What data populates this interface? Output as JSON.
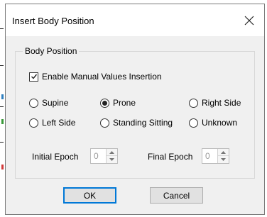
{
  "dialog": {
    "title": "Insert Body Position",
    "close_icon": "close-icon"
  },
  "group": {
    "legend": "Body Position",
    "enable_manual": {
      "label": "Enable Manual Values Insertion",
      "checked": true
    }
  },
  "positions": [
    {
      "label": "Supine",
      "selected": false
    },
    {
      "label": "Prone",
      "selected": true
    },
    {
      "label": "Right Side",
      "selected": false
    },
    {
      "label": "Left Side",
      "selected": false
    },
    {
      "label": "Standing Sitting",
      "selected": false
    },
    {
      "label": "Unknown",
      "selected": false
    }
  ],
  "epochs": {
    "initial_label": "Initial Epoch",
    "initial_value": "0",
    "final_label": "Final Epoch",
    "final_value": "0"
  },
  "buttons": {
    "ok": "OK",
    "cancel": "Cancel"
  },
  "colors": {
    "accent": "#0078d7",
    "dialog_bg": "#f0f0f0"
  }
}
